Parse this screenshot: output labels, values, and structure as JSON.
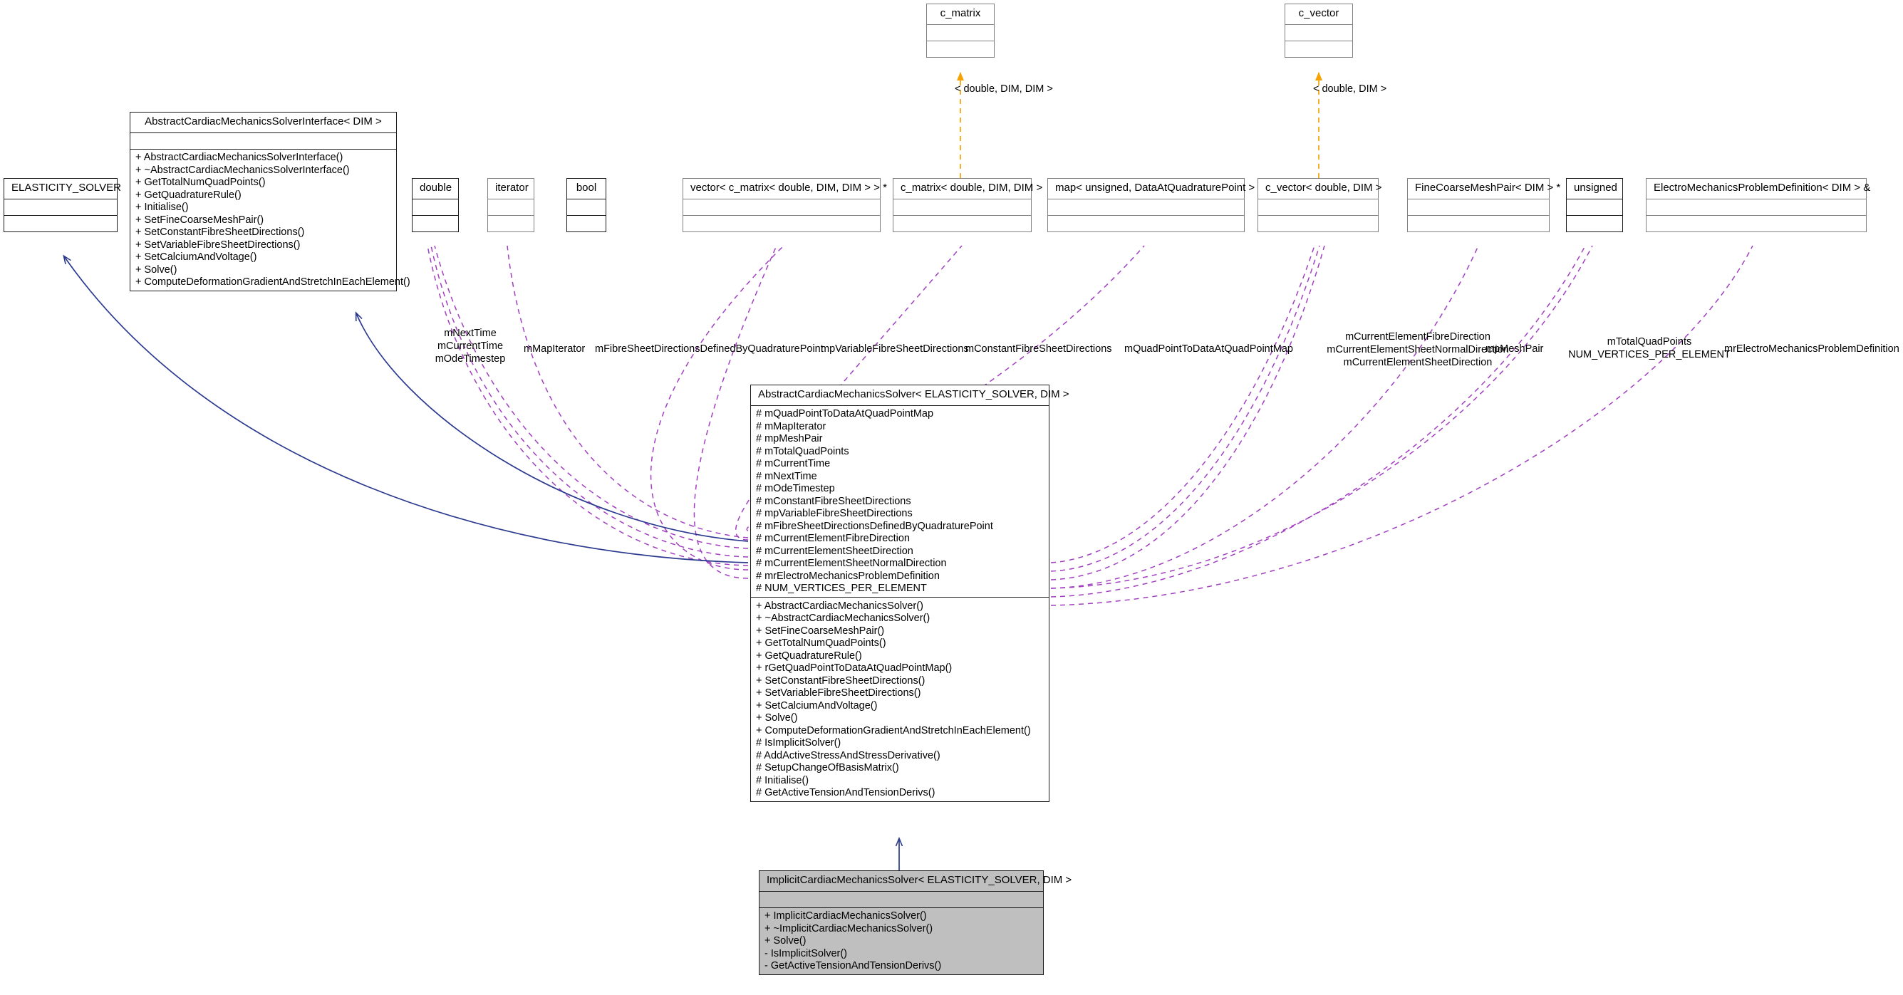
{
  "diagram": {
    "kind": "uml-class-collaboration-diagram",
    "colors": {
      "inheritance_edge": "#2b3a8f",
      "usage_edge": "#a23fc0",
      "template_edge": "#f5a202",
      "node_border_strong": "#1a1a1a",
      "node_border_light": "#808080",
      "node_fill_highlight": "#bfbfbf",
      "node_fill": "#ffffff"
    }
  },
  "nodes": {
    "elasticity_solver": {
      "title": "ELASTICITY_SOLVER",
      "attributes": [],
      "methods": []
    },
    "interface": {
      "title": "AbstractCardiacMechanicsSolverInterface< DIM >",
      "attributes": [],
      "methods": [
        "+ AbstractCardiacMechanicsSolverInterface()",
        "+ ~AbstractCardiacMechanicsSolverInterface()",
        "+ GetTotalNumQuadPoints()",
        "+ GetQuadratureRule()",
        "+ Initialise()",
        "+ SetFineCoarseMeshPair()",
        "+ SetConstantFibreSheetDirections()",
        "+ SetVariableFibreSheetDirections()",
        "+ SetCalciumAndVoltage()",
        "+ Solve()",
        "+ ComputeDeformationGradientAndStretchInEachElement()"
      ]
    },
    "c_matrix": {
      "title": "c_matrix",
      "attributes": [],
      "methods": []
    },
    "c_vector": {
      "title": "c_vector",
      "attributes": [],
      "methods": []
    },
    "double": {
      "title": "double",
      "attributes": [],
      "methods": []
    },
    "iterator": {
      "title": "iterator",
      "attributes": [],
      "methods": []
    },
    "bool": {
      "title": "bool",
      "attributes": [],
      "methods": []
    },
    "vector_c_matrix": {
      "title": "vector< c_matrix< double, DIM, DIM > > *",
      "attributes": [],
      "methods": []
    },
    "c_matrix_inst": {
      "title": "c_matrix< double, DIM, DIM >",
      "attributes": [],
      "methods": []
    },
    "map_unsigned": {
      "title": "map< unsigned, DataAtQuadraturePoint >",
      "attributes": [],
      "methods": []
    },
    "c_vector_inst": {
      "title": "c_vector< double, DIM >",
      "attributes": [],
      "methods": []
    },
    "fine_coarse": {
      "title": "FineCoarseMeshPair< DIM > *",
      "attributes": [],
      "methods": []
    },
    "unsigned": {
      "title": "unsigned",
      "attributes": [],
      "methods": []
    },
    "electro_def": {
      "title": "ElectroMechanicsProblemDefinition< DIM > &",
      "attributes": [],
      "methods": []
    },
    "abstract_solver": {
      "title": "AbstractCardiacMechanicsSolver< ELASTICITY_SOLVER, DIM >",
      "attributes": [
        "# mQuadPointToDataAtQuadPointMap",
        "# mMapIterator",
        "# mpMeshPair",
        "# mTotalQuadPoints",
        "# mCurrentTime",
        "# mNextTime",
        "# mOdeTimestep",
        "# mConstantFibreSheetDirections",
        "# mpVariableFibreSheetDirections",
        "# mFibreSheetDirectionsDefinedByQuadraturePoint",
        "# mCurrentElementFibreDirection",
        "# mCurrentElementSheetDirection",
        "# mCurrentElementSheetNormalDirection",
        "# mrElectroMechanicsProblemDefinition",
        "# NUM_VERTICES_PER_ELEMENT"
      ],
      "methods": [
        "+ AbstractCardiacMechanicsSolver()",
        "+ ~AbstractCardiacMechanicsSolver()",
        "+ SetFineCoarseMeshPair()",
        "+ GetTotalNumQuadPoints()",
        "+ GetQuadratureRule()",
        "+ rGetQuadPointToDataAtQuadPointMap()",
        "+ SetConstantFibreSheetDirections()",
        "+ SetVariableFibreSheetDirections()",
        "+ SetCalciumAndVoltage()",
        "+ Solve()",
        "+ ComputeDeformationGradientAndStretchInEachElement()",
        "# IsImplicitSolver()",
        "# AddActiveStressAndStressDerivative()",
        "# SetupChangeOfBasisMatrix()",
        "# Initialise()",
        "# GetActiveTensionAndTensionDerivs()"
      ]
    },
    "implicit_solver": {
      "title": "ImplicitCardiacMechanicsSolver< ELASTICITY_SOLVER, DIM >",
      "attributes": [],
      "methods": [
        "+ ImplicitCardiacMechanicsSolver()",
        "+ ~ImplicitCardiacMechanicsSolver()",
        "+ Solve()",
        "- IsImplicitSolver()",
        "- GetActiveTensionAndTensionDerivs()"
      ]
    }
  },
  "edge_labels": {
    "template_c_matrix": "< double, DIM, DIM >",
    "template_c_vector": "< double, DIM >",
    "double_group": "mNextTime\nmCurrentTime\nmOdeTimestep",
    "double_l1": "mNextTime",
    "double_l2": "mCurrentTime",
    "double_l3": "mOdeTimestep",
    "iterator": "mMapIterator",
    "bool": "mFibreSheetDirectionsDefinedByQuadraturePoint",
    "vector_c_matrix": "mpVariableFibreSheetDirections",
    "c_matrix_inst": "mConstantFibreSheetDirections",
    "map_unsigned": "mQuadPointToDataAtQuadPointMap",
    "c_vector_l1": "mCurrentElementFibreDirection",
    "c_vector_l2": "mCurrentElementSheetNormalDirection",
    "c_vector_l3": "mCurrentElementSheetDirection",
    "fine_coarse": "mpMeshPair",
    "unsigned_l1": "mTotalQuadPoints",
    "unsigned_l2": "NUM_VERTICES_PER_ELEMENT",
    "electro_def": "mrElectroMechanicsProblemDefinition"
  }
}
